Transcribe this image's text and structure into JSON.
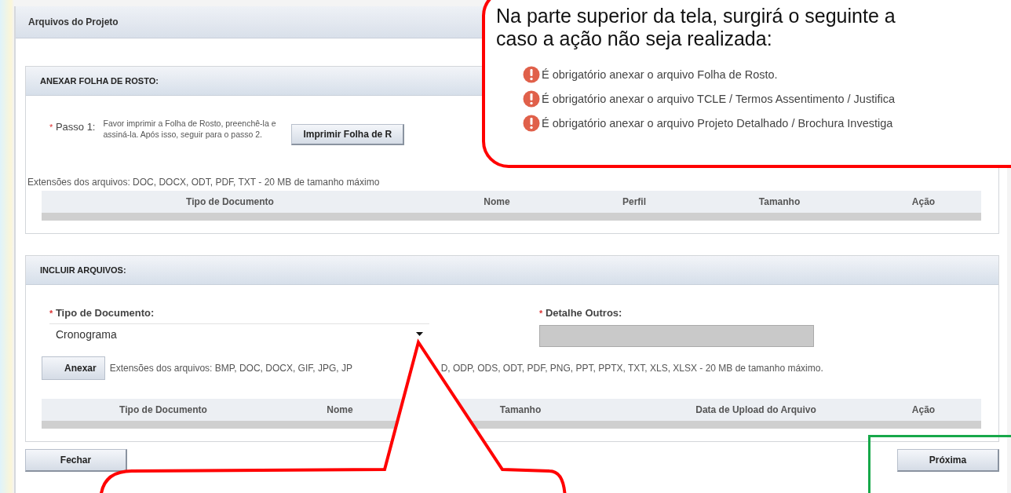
{
  "panel": {
    "title": "Arquivos do Projeto"
  },
  "sections": [
    {
      "kind": "cover",
      "title": "ANEXAR FOLHA DE ROSTO:",
      "required_mark": "*",
      "step_label": "Passo 1:",
      "step_text": "Favor imprimir a Folha de Rosto, preenchê-la e assiná-la. Após isso, seguir para o passo 2.",
      "print_button": "Imprimir Folha de R",
      "extensions": [
        "Extensões dos arquivos: DOC, DOCX, ODT, PDF, TXT - 20 MB de tamanho máximo"
      ],
      "columns": [
        "Tipo de Documento",
        "Nome",
        "Perfil",
        "Tamanho",
        "Ação"
      ]
    },
    {
      "kind": "include",
      "title": "INCLUIR ARQUIVOS:",
      "required_mark": "*",
      "type_label": "Tipo de Documento:",
      "type_value": "Cronograma",
      "detail_label": "Detalhe Outros:",
      "detail_disabled": true,
      "attach_button": "Anexar",
      "extensions": [
        "Extensões dos arquivos: BMP, DOC, DOCX, GIF, JPG, JP",
        "D, ODP, ODS, ODT, PDF, PNG, PPT, PPTX, TXT, XLS, XLSX - 20 MB de tamanho máximo."
      ],
      "columns": [
        "Tipo de Documento",
        "Nome",
        "Tamanho",
        "Data de Upload do Arquivo",
        "Ação"
      ]
    }
  ],
  "buttons": {
    "close": "Fechar",
    "next": "Próxima"
  },
  "callout": {
    "lines": [
      "Na parte superior da tela, surgirá o seguinte a",
      "caso a ação não seja realizada:"
    ],
    "errors": [
      "É obrigatório anexar o arquivo Folha de Rosto.",
      "É obrigatório anexar o arquivo TCLE / Termos Assentimento / Justifica",
      "É obrigatório anexar o arquivo Projeto Detalhado / Brochura Investiga"
    ]
  }
}
